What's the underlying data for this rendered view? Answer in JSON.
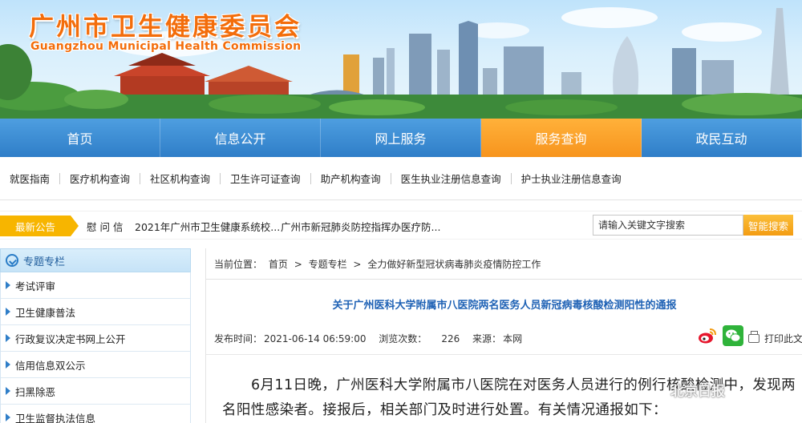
{
  "site": {
    "title_cn": "广州市卫生健康委员会",
    "title_en": "Guangzhou Municipal Health Commission"
  },
  "main_nav": [
    "首页",
    "信息公开",
    "网上服务",
    "服务查询",
    "政民互动"
  ],
  "main_nav_active": "服务查询",
  "sub_nav": [
    "就医指南",
    "医疗机构查询",
    "社区机构查询",
    "卫生许可证查询",
    "助产机构查询",
    "医生执业注册信息查询",
    "护士执业注册信息查询"
  ],
  "notice": {
    "tag": "最新公告",
    "items": [
      "慰 问 信",
      "2021年广州市卫生健康系统校...",
      "广州市新冠肺炎防控指挥办医疗防..."
    ]
  },
  "search": {
    "placeholder": "请输入关键文字搜索",
    "button": "智能搜索"
  },
  "sidebar": {
    "heading": "专题专栏",
    "items": [
      "考试评审",
      "卫生健康普法",
      "行政复议决定书网上公开",
      "信用信息双公示",
      "扫黑除恶",
      "卫生监督执法信息"
    ]
  },
  "breadcrumb": {
    "label": "当前位置：",
    "items": [
      "首页",
      "专题专栏",
      "全力做好新型冠状病毒肺炎疫情防控工作"
    ],
    "separator": ">"
  },
  "article": {
    "title": "关于广州医科大学附属市八医院两名医务人员新冠病毒核酸检测阳性的通报",
    "publish_label": "发布时间：",
    "publish_time": "2021-06-14 06:59:00",
    "views_label": "浏览次数：",
    "views": "226",
    "source_label": "来源：",
    "source": "本网",
    "print_label": "打印此文",
    "body": "6月11日晚，广州医科大学附属市八医院在对医务人员进行的例行核酸检测中，发现两名阳性感染者。接报后，相关部门及时进行处置。有关情况通报如下："
  },
  "watermark": "北京日报",
  "colors": {
    "nav_blue": "#2f7ec8",
    "nav_active_orange": "#f7941d",
    "logo_orange": "#f36d0b",
    "title_blue": "#1f62b5",
    "notice_yellow": "#f7b500"
  }
}
